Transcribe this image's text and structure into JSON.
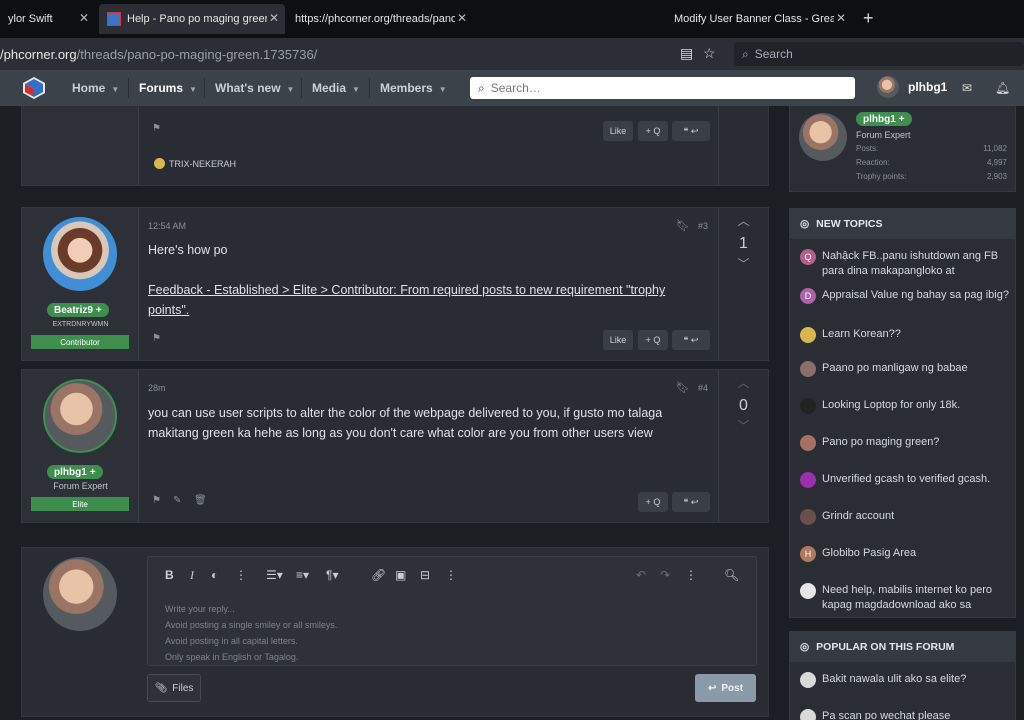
{
  "browser": {
    "tabs": [
      {
        "title": "ylor Swift"
      },
      {
        "title": "Help - Pano po maging green?"
      },
      {
        "title": "https://phcorner.org/threads/pano"
      },
      {
        "title": "Modify User Banner Class - Greasem"
      }
    ],
    "url_host": "/phcorner.org",
    "url_path": "/threads/pano-po-maging-green.1735736/",
    "search_placeholder": "Search"
  },
  "nav": {
    "items": [
      {
        "label": "Home"
      },
      {
        "label": "Forums"
      },
      {
        "label": "What's new"
      },
      {
        "label": "Media"
      },
      {
        "label": "Members"
      }
    ],
    "search_placeholder": "Search…",
    "username": "plhbg1"
  },
  "post1": {
    "like_label": "Like",
    "quote_label": "+ Q",
    "signature": "TRIX-NEKERAH"
  },
  "post2": {
    "time": "12:54 AM",
    "number": "#3",
    "text": "Here's how po",
    "link": "Feedback - Established > Elite > Contributor: From required posts to new requirement \"trophy points\".",
    "votes": "1",
    "username": "Beatriz9",
    "user_title": "EXTRDNRYWMN",
    "role": "Contributor",
    "like_label": "Like",
    "quote_label": "+ Q"
  },
  "post3": {
    "time": "28m",
    "number": "#4",
    "text": "you can use user scripts to alter the color of the webpage delivered to you, if gusto mo talaga makitang green ka hehe as long as you don't care what color are you from other users view",
    "votes": "0",
    "username": "plhbg1",
    "user_title": "Forum Expert",
    "role": "Elite",
    "quote_label": "+ Q"
  },
  "editor": {
    "placeholder_lines": [
      "Write your reply...",
      "Avoid posting a single smiley or all smileys.",
      "Avoid posting in all capital letters.",
      "Only speak in English or Tagalog."
    ],
    "files_label": "Files",
    "post_label": "Post"
  },
  "profile_card": {
    "username": "plhbg1",
    "title": "Forum Expert",
    "stats": [
      {
        "label": "Posts:",
        "value": "11,082"
      },
      {
        "label": "Reaction:",
        "value": "4,997"
      },
      {
        "label": "Trophy points:",
        "value": "2,903"
      }
    ]
  },
  "new_topics": {
    "heading": "NEW TOPICS",
    "items": [
      {
        "title": "Nahậck FB..panu ishutdown ang FB para dina makapangloko at",
        "initial": "Q",
        "color": "#b85c8a"
      },
      {
        "title": "Appraisal Value ng bahay sa pag ibig?",
        "initial": "D",
        "color": "#b061a8"
      },
      {
        "title": "Learn Korean??",
        "initial": "",
        "color": "#d8b64a"
      },
      {
        "title": "Paano po manligaw ng babae",
        "initial": "",
        "color": "#8a6f6a"
      },
      {
        "title": "Looking Loptop for only 18k.",
        "initial": "",
        "color": "#222"
      },
      {
        "title": "Pano po maging green?",
        "initial": "",
        "color": "#a87060"
      },
      {
        "title": "Unverified gcash to verified gcash.",
        "initial": "",
        "color": "#9b2fae"
      },
      {
        "title": "Grindr account",
        "initial": "",
        "color": "#6a5048"
      },
      {
        "title": "Globibo Pasig Area",
        "initial": "H",
        "color": "#b07a5a"
      },
      {
        "title": "Need help, mabilis internet ko pero kapag magdadownload ako sa",
        "initial": "",
        "color": "#e6e6e6"
      }
    ]
  },
  "popular": {
    "heading": "POPULAR ON THIS FORUM",
    "items": [
      {
        "title": "Bakit nawala ulit ako sa elite?"
      },
      {
        "title": "Pa scan po wechat please"
      }
    ]
  }
}
